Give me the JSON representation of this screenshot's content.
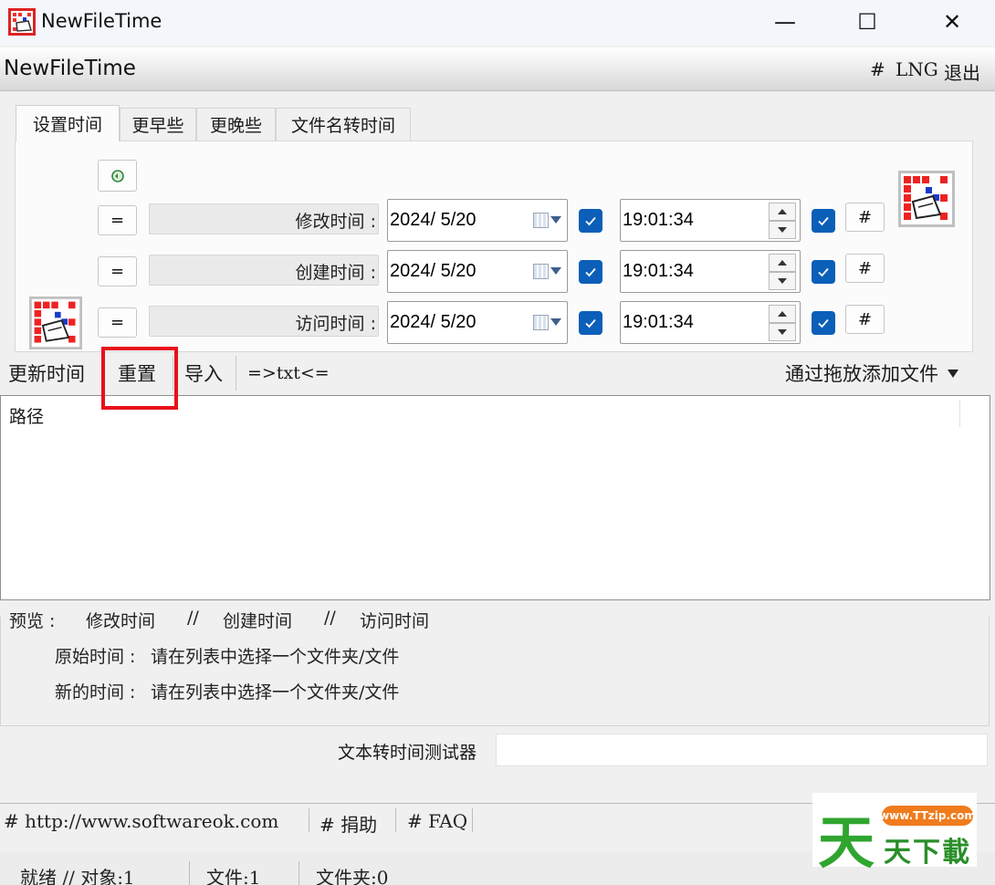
{
  "window": {
    "title": "NewFileTime",
    "minimize": "—",
    "maximize": "☐",
    "close": "✕"
  },
  "header": {
    "app_title": "NewFileTime",
    "menu": [
      "#",
      "LNG",
      "退出"
    ]
  },
  "tabs": [
    "设置时间",
    "更早些",
    "更晚些",
    "文件名转时间"
  ],
  "panel": {
    "eq_label": "=",
    "hash_label": "#",
    "rows": [
      {
        "label": "修改时间 :",
        "date": "2024/  5/20",
        "time": "19:01:34",
        "date_checked": true,
        "time_checked": true
      },
      {
        "label": "创建时间 :",
        "date": "2024/  5/20",
        "time": "19:01:34",
        "date_checked": true,
        "time_checked": true
      },
      {
        "label": "访问时间 :",
        "date": "2024/  5/20",
        "time": "19:01:34",
        "date_checked": true,
        "time_checked": true
      }
    ]
  },
  "toolbar": {
    "update": "更新时间",
    "reset": "重置",
    "import": "导入",
    "txt": "=>txt<=",
    "add_files": "通过拖放添加文件"
  },
  "list": {
    "column_header": "路径"
  },
  "preview": {
    "label": "预览 :",
    "col1": "修改时间",
    "sep": "//",
    "col2": "创建时间",
    "col3": "访问时间",
    "original_label": "原始时间 :",
    "original_value": "请在列表中选择一个文件夹/文件",
    "new_label": "新的时间 :",
    "new_value": "请在列表中选择一个文件夹/文件"
  },
  "tester": {
    "label": "文本转时间测试器",
    "value": ""
  },
  "links": [
    "# http://www.softwareok.com",
    "# 捐助",
    "# FAQ"
  ],
  "status": {
    "ready": "就绪 // 对象:1",
    "files": "文件:1",
    "folders": "文件夹:0"
  },
  "watermark": {
    "big": "天",
    "pill": "www.TTzip.com",
    "sub": "天下載"
  },
  "colors": {
    "accent": "#0b5fb8",
    "highlight": "#e8101a"
  }
}
